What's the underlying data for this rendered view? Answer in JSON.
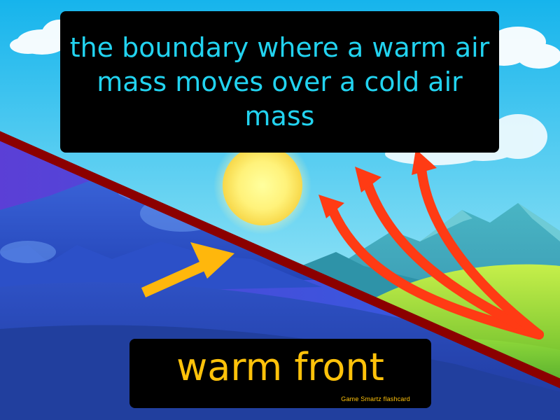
{
  "card": {
    "definition": "the boundary where a warm air mass moves over a cold air mass",
    "term": "warm front",
    "footer": "Game Smartz flashcard"
  },
  "colors": {
    "definition_text": "#22d3f0",
    "term_text": "#ffc20a",
    "panel_background": "#000000",
    "front_line": "#8b0000",
    "warm_arrows": "#ff3b14",
    "cold_arrow": "#ffb70c"
  },
  "icons": [
    "sun-icon",
    "cloud-icon",
    "mountain-icon",
    "arrow-icon"
  ]
}
